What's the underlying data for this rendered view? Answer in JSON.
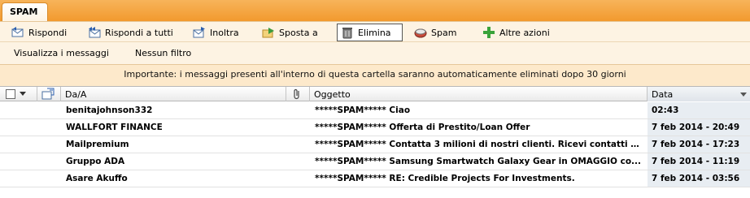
{
  "folder_tab": "SPAM",
  "toolbar": {
    "reply": "Rispondi",
    "reply_all": "Rispondi a tutti",
    "forward": "Inoltra",
    "move": "Sposta a",
    "delete": "Elimina",
    "spam": "Spam",
    "more": "Altre azioni"
  },
  "subbar": {
    "view": "Visualizza i messaggi",
    "filter": "Nessun filtro"
  },
  "notice": "Importante: i messaggi presenti all'interno di questa cartella saranno automaticamente eliminati dopo 30 giorni",
  "columns": {
    "from": "Da/A",
    "subject": "Oggetto",
    "date": "Data"
  },
  "messages": [
    {
      "from": "benitajohnson332",
      "subject": "*****SPAM***** Ciao",
      "date": "02:43"
    },
    {
      "from": "WALLFORT FINANCE",
      "subject": "*****SPAM***** Offerta di Prestito/Loan Offer",
      "date": "7 feb 2014 - 20:49"
    },
    {
      "from": "Mailpremium",
      "subject": "*****SPAM***** Contatta 3 milioni di nostri clienti. Ricevi contatti e ...",
      "date": "7 feb 2014 - 17:23"
    },
    {
      "from": "Gruppo ADA",
      "subject": "*****SPAM***** Samsung Smartwatch Galaxy Gear in OMAGGIO co...",
      "date": "7 feb 2014 - 11:19"
    },
    {
      "from": "Asare Akuffo",
      "subject": "*****SPAM***** RE: Credible Projects For Investments.",
      "date": "7 feb 2014 - 03:56"
    }
  ],
  "colors": {
    "band": "#f29a2e",
    "toolbar_bg": "#fdf3e3",
    "notice_bg": "#fde9cb",
    "date_col_bg": "#e8edf2"
  }
}
